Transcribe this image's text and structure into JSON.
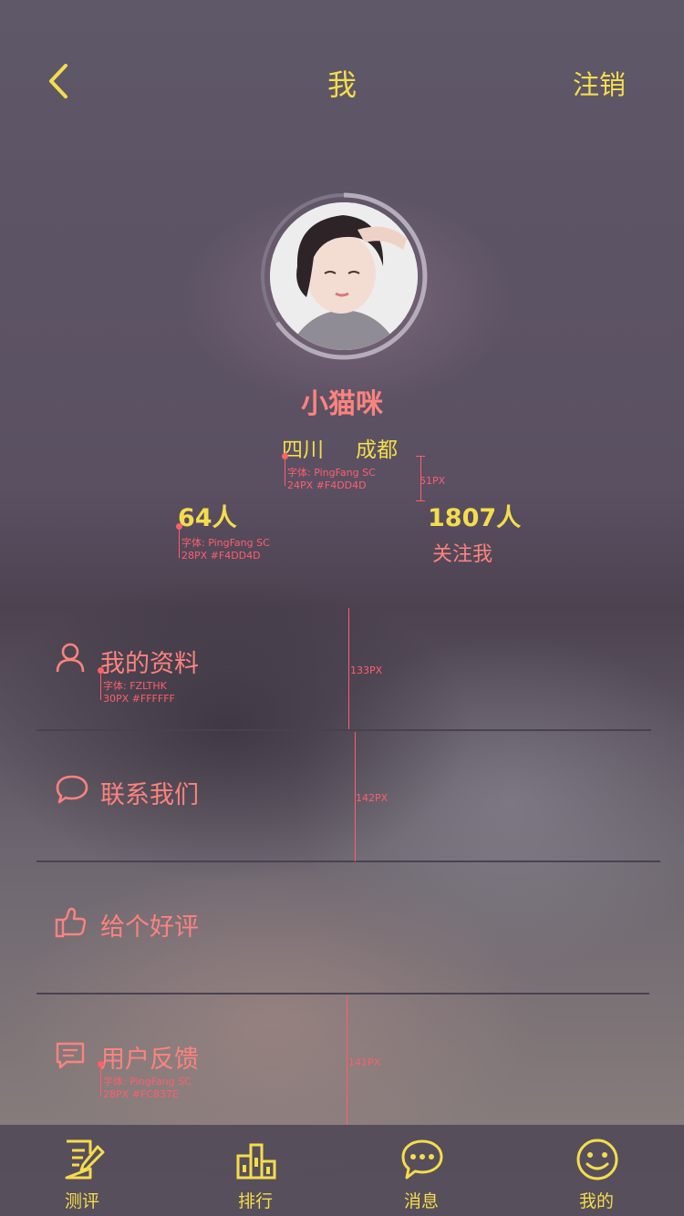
{
  "header": {
    "title": "我",
    "logout_label": "注销",
    "back_icon": "chevron-left-icon"
  },
  "profile": {
    "nickname": "小猫咪",
    "province": "四川",
    "city": "成都",
    "following_count": "64人",
    "followers_count": "1807人",
    "followers_label": "关注我"
  },
  "menu": {
    "items": [
      {
        "label": "我的资料",
        "icon": "user-icon"
      },
      {
        "label": "联系我们",
        "icon": "chat-bubble-icon"
      },
      {
        "label": "给个好评",
        "icon": "thumbs-up-icon"
      },
      {
        "label": "用户反馈",
        "icon": "feedback-icon"
      }
    ]
  },
  "tabbar": {
    "items": [
      {
        "label": "测评",
        "icon": "edit-document-icon"
      },
      {
        "label": "排行",
        "icon": "ranking-icon"
      },
      {
        "label": "消息",
        "icon": "message-icon"
      },
      {
        "label": "我的",
        "icon": "smile-icon"
      }
    ]
  },
  "annotations": {
    "location_font": "字体: PingFang SC",
    "location_spec": "24PX #F4DD4D",
    "location_gap": "51PX",
    "count_font": "字体: PingFang SC",
    "count_spec": "28PX #F4DD4D",
    "menu_font": "字体: FZLTHK",
    "menu_spec": "30PX #FFFFFF",
    "row1_height": "133PX",
    "row2_height": "142PX",
    "feedback_font": "字体: PingFang SC",
    "feedback_spec": "28PX #FC837E",
    "row4_height": "141PX"
  },
  "colors": {
    "accent_yellow": "#F4DD4D",
    "accent_coral": "#FC837E",
    "annotation_red": "#FF5E6D"
  }
}
